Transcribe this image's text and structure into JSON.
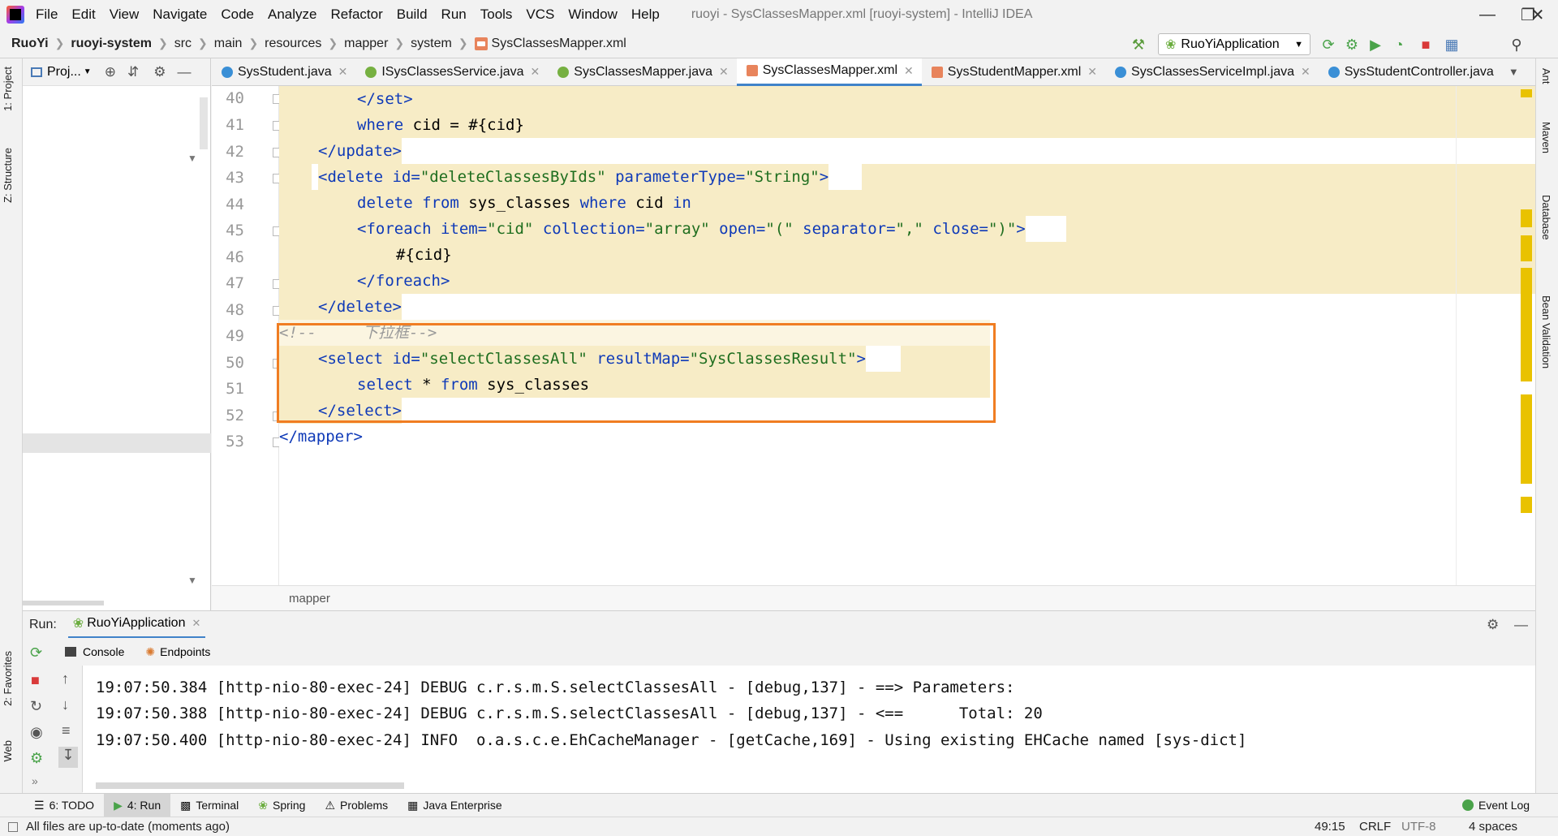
{
  "app": {
    "title": "ruoyi - SysClassesMapper.xml [ruoyi-system] - IntelliJ IDEA"
  },
  "menu": [
    "File",
    "Edit",
    "View",
    "Navigate",
    "Code",
    "Analyze",
    "Refactor",
    "Build",
    "Run",
    "Tools",
    "VCS",
    "Window",
    "Help"
  ],
  "breadcrumb": [
    "RuoYi",
    "ruoyi-system",
    "src",
    "main",
    "resources",
    "mapper",
    "system",
    "SysClassesMapper.xml"
  ],
  "run_config": "RuoYiApplication",
  "project_pane": {
    "label": "Proj..."
  },
  "left_tabs": [
    "1: Project",
    "Z: Structure",
    "2: Favorites",
    "Web"
  ],
  "right_tabs": [
    "Ant",
    "Maven",
    "Database",
    "Bean Validation"
  ],
  "tabs": [
    {
      "label": "SysStudent.java",
      "color": "#3a8fd6"
    },
    {
      "label": "ISysClassesService.java",
      "color": "#76b041"
    },
    {
      "label": "SysClassesMapper.java",
      "color": "#76b041"
    },
    {
      "label": "SysClassesMapper.xml",
      "color": "#e8845c",
      "active": true
    },
    {
      "label": "SysStudentMapper.xml",
      "color": "#e8845c"
    },
    {
      "label": "SysClassesServiceImpl.java",
      "color": "#3a8fd6"
    },
    {
      "label": "SysStudentController.java",
      "color": "#3a8fd6"
    }
  ],
  "line_numbers": [
    "40",
    "41",
    "42",
    "43",
    "44",
    "45",
    "46",
    "47",
    "48",
    "49",
    "50",
    "51",
    "52",
    "53"
  ],
  "code": {
    "l40_a": "</",
    "l40_b": "set",
    "l40_c": ">",
    "l41_a": "where",
    "l41_b": " cid = #{cid}",
    "l42_a": "</",
    "l42_b": "update",
    "l42_c": ">",
    "l43_a": "<",
    "l43_b": "delete",
    "l43_c": " id=",
    "l43_d": "\"deleteClassesByIds\"",
    "l43_e": " parameterType=",
    "l43_f": "\"String\"",
    "l43_g": ">",
    "l44_a": "delete",
    "l44_b": " ",
    "l44_c": "from",
    "l44_d": " sys_classes ",
    "l44_e": "where",
    "l44_f": " cid ",
    "l44_g": "in",
    "l45_a": "<",
    "l45_b": "foreach",
    "l45_c": " item=",
    "l45_d": "\"cid\"",
    "l45_e": " collection=",
    "l45_f": "\"array\"",
    "l45_g": " open=",
    "l45_h": "\"(\"",
    "l45_i": " separator=",
    "l45_j": "\",\"",
    "l45_k": " close=",
    "l45_l": "\")\"",
    "l45_m": ">",
    "l46_a": "#{cid}",
    "l47_a": "</",
    "l47_b": "foreach",
    "l47_c": ">",
    "l48_a": "</",
    "l48_b": "delete",
    "l48_c": ">",
    "l49_a": "<!--     下拉框-->",
    "l50_a": "<",
    "l50_b": "select",
    "l50_c": " id=",
    "l50_d": "\"selectClassesAll\"",
    "l50_e": " resultMap=",
    "l50_f": "\"SysClassesResult\"",
    "l50_g": ">",
    "l51_a": "select",
    "l51_b": " * ",
    "l51_c": "from",
    "l51_d": " sys_classes",
    "l52_a": "</",
    "l52_b": "select",
    "l52_c": ">",
    "l53_a": "</",
    "l53_b": "mapper",
    "l53_c": ">"
  },
  "editor_footer": "mapper",
  "run_panel": {
    "label": "Run:",
    "tab": "RuoYiApplication",
    "subtabs": [
      "Console",
      "Endpoints"
    ],
    "lines": [
      "19:07:50.384 [http-nio-80-exec-24] DEBUG c.r.s.m.S.selectClassesAll - [debug,137] - ==> Parameters: ",
      "19:07:50.388 [http-nio-80-exec-24] DEBUG c.r.s.m.S.selectClassesAll - [debug,137] - <==      Total: 20",
      "19:07:50.400 [http-nio-80-exec-24] INFO  o.a.s.c.e.EhCacheManager - [getCache,169] - Using existing EHCache named [sys-dict]"
    ]
  },
  "bottom_tools": [
    "6: TODO",
    "4: Run",
    "Terminal",
    "Spring",
    "Problems",
    "Java Enterprise"
  ],
  "event_log": "Event Log",
  "status": {
    "message": "All files are up-to-date (moments ago)",
    "position": "49:15",
    "line_sep": "CRLF",
    "encoding": "UTF-8",
    "indent": "4 spaces"
  }
}
